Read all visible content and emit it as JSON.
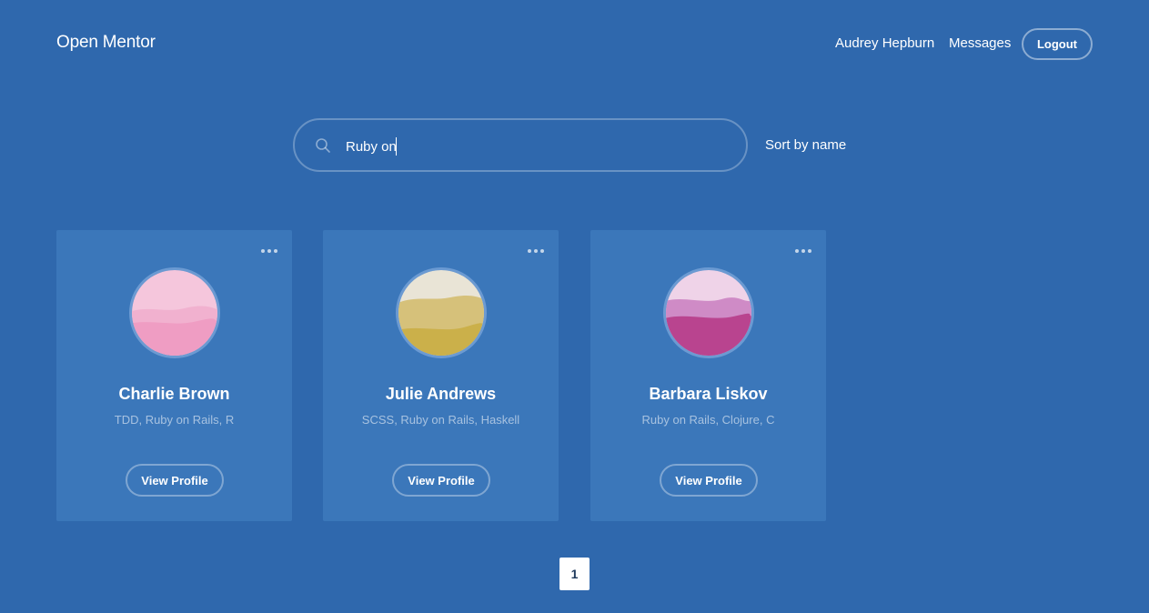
{
  "header": {
    "brand": "Open Mentor",
    "user_name": "Audrey Hepburn",
    "messages_label": "Messages",
    "logout_label": "Logout"
  },
  "search": {
    "value": "Ruby on",
    "icon": "search-icon"
  },
  "sort": {
    "label": "Sort by name"
  },
  "cards": [
    {
      "name": "Charlie Brown",
      "skills": "TDD, Ruby on Rails, R",
      "button_label": "View Profile",
      "avatar_colors": [
        "#f5c6dc",
        "#f1b1cf",
        "#ef9dc3"
      ]
    },
    {
      "name": "Julie Andrews",
      "skills": "SCSS, Ruby on Rails, Haskell",
      "button_label": "View Profile",
      "avatar_colors": [
        "#e9e4d6",
        "#d6c17a",
        "#cbb04a"
      ]
    },
    {
      "name": "Barbara Liskov",
      "skills": "Ruby on Rails, Clojure, C",
      "button_label": "View Profile",
      "avatar_colors": [
        "#efd3e8",
        "#cf8bc6",
        "#b9448f"
      ]
    }
  ],
  "pagination": {
    "current_page": "1"
  },
  "colors": {
    "background": "#2f68ad",
    "card": "#3b77ba"
  }
}
